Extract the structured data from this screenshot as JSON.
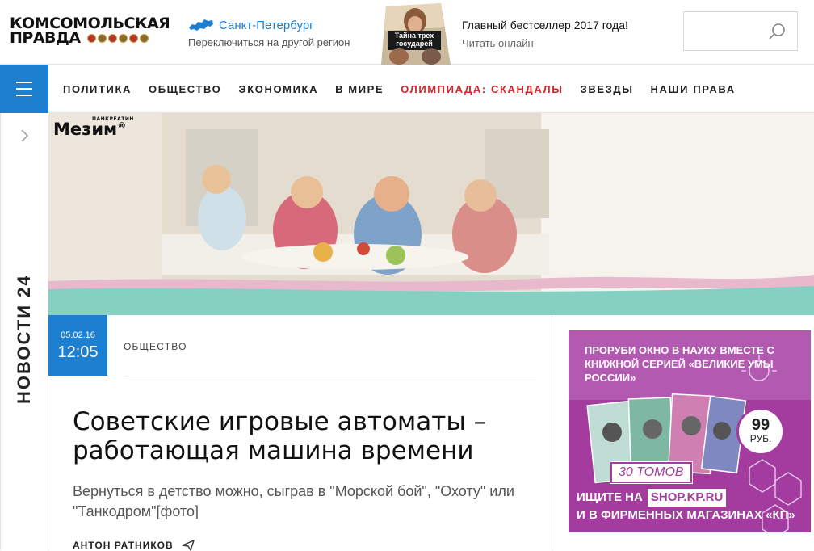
{
  "header": {
    "logo_line1": "КОМСОМОЛЬСКАЯ",
    "logo_line2": "ПРАВДА",
    "region_name": "Санкт-Петербург",
    "region_switch": "Переключиться на другой регион",
    "book_cover_title": "Тайна трех государей",
    "promo_title": "Главный бестселлер 2017 года!",
    "promo_link": "Читать онлайн",
    "search_placeholder": ""
  },
  "nav": {
    "items": [
      {
        "label": "ПОЛИТИКА"
      },
      {
        "label": "ОБЩЕСТВО"
      },
      {
        "label": "ЭКОНОМИКА"
      },
      {
        "label": "В МИРЕ"
      },
      {
        "label": "ОЛИМПИАДА: СКАНДАЛЫ"
      },
      {
        "label": "ЗВЕЗДЫ"
      },
      {
        "label": "НАШИ ПРАВА"
      }
    ],
    "hot_color": "#d8232a",
    "accent_color": "#1d7fd0"
  },
  "rail": {
    "label": "НОВОСТИ 24"
  },
  "banner": {
    "brand": "Мезим",
    "brand_small": "ПАНКРЕАТИН",
    "brand_mark": "®"
  },
  "article": {
    "date": "05.02.16",
    "time": "12:05",
    "rubric": "ОБЩЕСТВО",
    "headline": "Советские игровые автоматы – работающая машина времени",
    "lead": "Вернуться в детство можно, сыграв в \"Морской бой\", \"Охоту\" или \"Танкодром\"[фото]",
    "author": "АНТОН РАТНИКОВ"
  },
  "ad": {
    "headline": "ПРОРУБИ ОКНО В НАУКУ ВМЕСТЕ С КНИЖНОЙ СЕРИЕЙ «ВЕЛИКИЕ УМЫ РОССИИ»",
    "price": "99",
    "currency": "РУБ.",
    "volumes": "30 ТОМОВ",
    "line1_prefix": "ИЩИТЕ НА",
    "shop": "SHOP.KP.RU",
    "line2": "И В ФИРМЕННЫХ МАГАЗИНАХ «КП»",
    "background": "#a43b9e"
  }
}
